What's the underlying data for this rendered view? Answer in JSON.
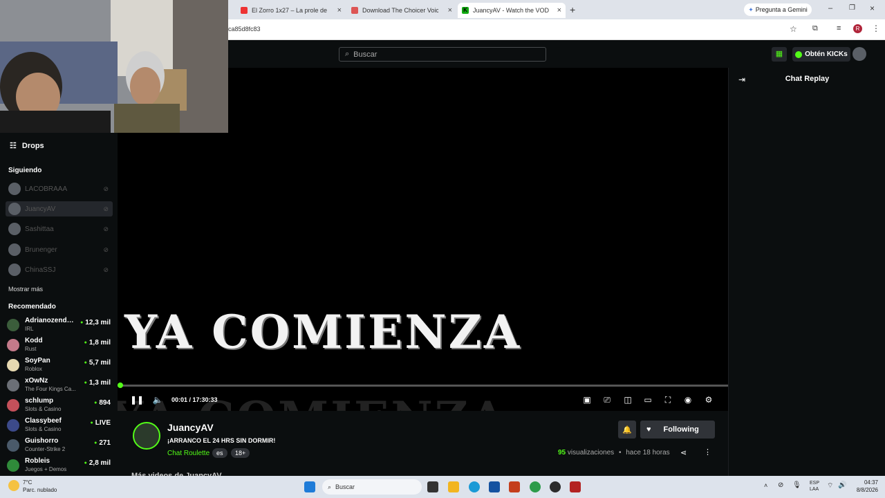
{
  "browser": {
    "tabs": [
      {
        "label": "El Zorro 1x27 – La prole de El A",
        "color": "#e33"
      },
      {
        "label": "Download The Choicer Voicer b",
        "color": "#d55"
      },
      {
        "label": "JuancyAV - Watch the VOD on",
        "color": "#1a1"
      }
    ],
    "new_tab": "+",
    "gemini": "Pregunta a Gemini",
    "url": "ca85d8fc83",
    "profile_initial": "R"
  },
  "header": {
    "search_placeholder": "Buscar",
    "get_kicks": "Obtén KICKs"
  },
  "sidebar": {
    "drops": "Drops",
    "following_title": "Siguiendo",
    "following": [
      {
        "name": "LACOBRAAA"
      },
      {
        "name": "JuancyAV"
      },
      {
        "name": "Sashittaa"
      },
      {
        "name": "Brunenger"
      },
      {
        "name": "ChinaSSJ"
      }
    ],
    "show_more": "Mostrar más",
    "recommended_title": "Recomendado",
    "recommended": [
      {
        "name": "Adrianozendej...",
        "category": "IRL",
        "viewers": "12,3 mil"
      },
      {
        "name": "Kodd",
        "category": "Rust",
        "viewers": "1,8 mil"
      },
      {
        "name": "SoyPan",
        "category": "Roblox",
        "viewers": "5,7 mil"
      },
      {
        "name": "xOwNz",
        "category": "The Four Kings Ca...",
        "viewers": "1,3 mil"
      },
      {
        "name": "schlump",
        "category": "Slots & Casino",
        "viewers": "894"
      },
      {
        "name": "Classybeef",
        "category": "Slots & Casino",
        "viewers": "LIVE"
      },
      {
        "name": "Guishorro",
        "category": "Counter-Strike 2",
        "viewers": "271"
      },
      {
        "name": "Robleis",
        "category": "Juegos + Demos",
        "viewers": "2,8 mil"
      }
    ]
  },
  "video": {
    "overlay_text": "YA COMIENZA",
    "time": "00:01 / 17:30:33",
    "progress": 0.0
  },
  "chat": {
    "title": "Chat Replay"
  },
  "stream": {
    "name": "JuancyAV",
    "title": "¡ARRANCO EL 24 HRS SIN DORMIR!",
    "category": "Chat Roulette",
    "tags": [
      "es",
      "18+"
    ],
    "follow_label": "Following",
    "views_count": "95",
    "views_label": "visualizaciones",
    "ago": "hace 18 horas",
    "more_videos": "Más videos de JuancyAV"
  },
  "taskbar": {
    "weather_temp": "7°C",
    "weather_desc": "Parc. nublado",
    "search": "Buscar",
    "lang": "ESP",
    "lang2": "LAA",
    "time": "04:37",
    "date": "8/8/2026"
  },
  "colors": {
    "accent": "#53fc18",
    "bg": "#0b0e0f"
  }
}
